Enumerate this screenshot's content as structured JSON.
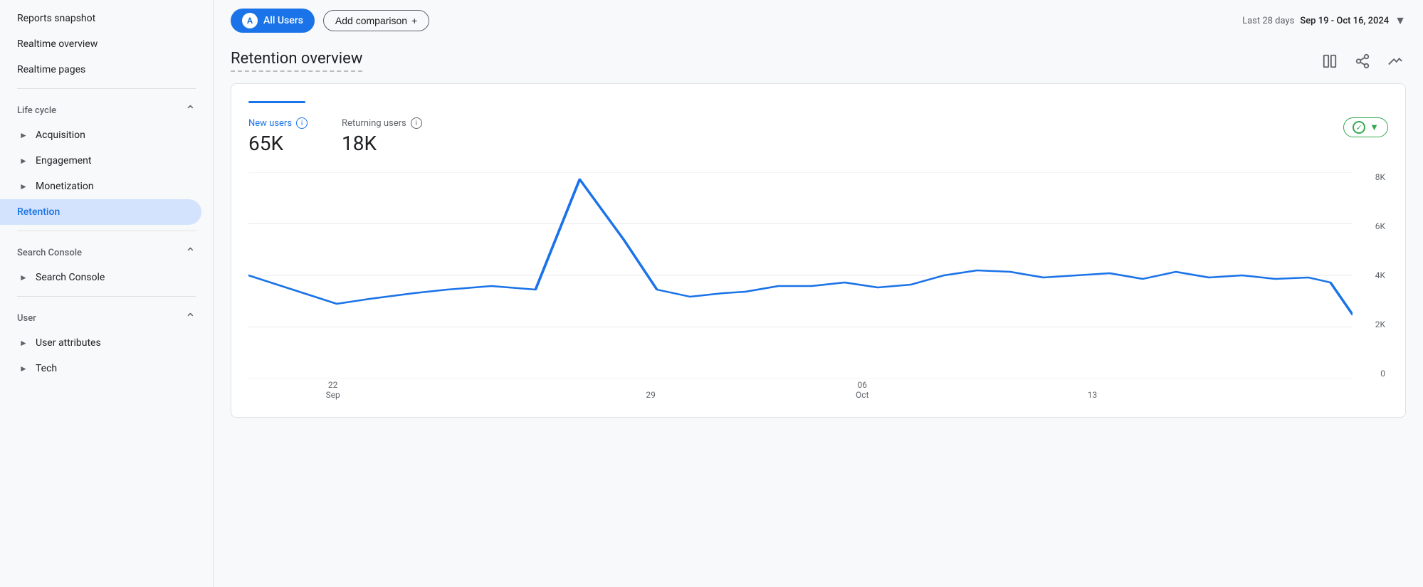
{
  "sidebar": {
    "items": [
      {
        "id": "reports-snapshot",
        "label": "Reports snapshot",
        "active": false,
        "hasArrow": false
      },
      {
        "id": "realtime-overview",
        "label": "Realtime overview",
        "active": false,
        "hasArrow": false
      },
      {
        "id": "realtime-pages",
        "label": "Realtime pages",
        "active": false,
        "hasArrow": false
      }
    ],
    "sections": [
      {
        "id": "life-cycle",
        "label": "Life cycle",
        "collapsed": false,
        "items": [
          {
            "id": "acquisition",
            "label": "Acquisition",
            "active": false
          },
          {
            "id": "engagement",
            "label": "Engagement",
            "active": false
          },
          {
            "id": "monetization",
            "label": "Monetization",
            "active": false
          },
          {
            "id": "retention",
            "label": "Retention",
            "active": true
          }
        ]
      },
      {
        "id": "search-console",
        "label": "Search Console",
        "collapsed": false,
        "items": [
          {
            "id": "search-console-item",
            "label": "Search Console",
            "active": false
          }
        ]
      },
      {
        "id": "user",
        "label": "User",
        "collapsed": false,
        "items": [
          {
            "id": "user-attributes",
            "label": "User attributes",
            "active": false
          },
          {
            "id": "tech",
            "label": "Tech",
            "active": false
          }
        ]
      }
    ]
  },
  "topbar": {
    "segment_label": "All Users",
    "segment_avatar": "A",
    "add_comparison_label": "Add comparison",
    "date_range_label": "Last 28 days",
    "date_range_value": "Sep 19 - Oct 16, 2024"
  },
  "page": {
    "title": "Retention overview",
    "tabs": [
      {
        "id": "tab1",
        "label": "",
        "active": true
      }
    ]
  },
  "metrics": {
    "new_users_label": "New users",
    "new_users_value": "65K",
    "returning_users_label": "Returning users",
    "returning_users_value": "18K",
    "filter_label": ""
  },
  "chart": {
    "y_labels": [
      "8K",
      "6K",
      "4K",
      "2K",
      "0"
    ],
    "x_labels": [
      {
        "text": "22\nSep",
        "pos": 22
      },
      {
        "text": "29",
        "pos": 40
      },
      {
        "text": "06\nOct",
        "pos": 58
      },
      {
        "text": "13",
        "pos": 76
      }
    ],
    "line_color": "#1a73e8"
  },
  "icons": {
    "compare_columns": "⊟",
    "share": "↗",
    "trend": "∿",
    "chevron_down": "▾",
    "plus": "+",
    "info": "i",
    "check": "✓"
  }
}
